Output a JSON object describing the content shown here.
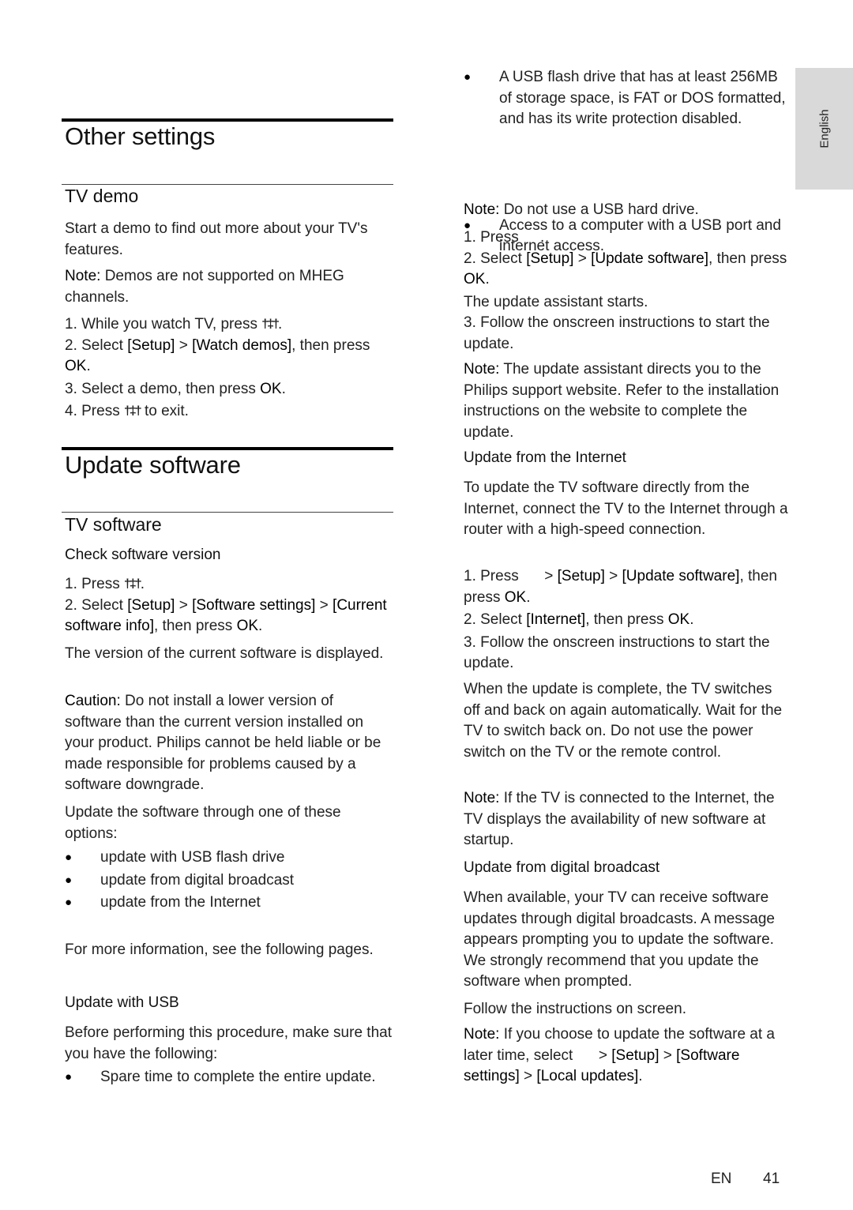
{
  "side_tab": {
    "language": "English"
  },
  "left": {
    "other_settings": {
      "title": "Other settings",
      "tv_demo": {
        "title": "TV demo",
        "intro": "Start a demo to find out more about your TV's features.",
        "note_label": "Note:",
        "note_text": " Demos are not supported on MHEG channels.",
        "step1_pre": "1. While you watch TV, press ",
        "step1_post": ".",
        "step2_pre": "2. Select ",
        "step2_a": "[Setup]",
        "step2_sep": " > ",
        "step2_b": "[Watch demos]",
        "step2_post": ", then press ",
        "step2_ok": "OK",
        "step2_end": ".",
        "step3_pre": "3. Select a demo, then press ",
        "step3_ok": "OK",
        "step3_end": ".",
        "step4_pre": "4. Press ",
        "step4_post": " to exit."
      }
    },
    "update_software": {
      "title": "Update software",
      "tv_software": {
        "title": "TV software",
        "check_heading": "Check software version",
        "step1_pre": "1. Press ",
        "step1_post": ".",
        "step2_pre": "2. Select ",
        "step2_a": "[Setup]",
        "sep": " > ",
        "step2_b": "[Software settings]",
        "step2_c": "[Current software info]",
        "step2_post": ", then press ",
        "ok": "OK",
        "dot": ".",
        "version_text": "The version of the current software is displayed.",
        "caution_label": "Caution:",
        "caution_text": " Do not install a lower version of software than the current version installed on your product. Philips cannot be held liable or be made responsible for problems caused by a software downgrade.",
        "options_intro": "Update the software through one of these options:",
        "options": [
          "update with USB flash drive",
          "update from digital broadcast",
          "update from the Internet"
        ],
        "more_info": "For more information, see the following pages.",
        "usb_heading": "Update with USB",
        "usb_intro": "Before performing this procedure, make sure that you have the following:",
        "usb_req_1": "Spare time to complete the entire update."
      }
    }
  },
  "right": {
    "usb_reqs": [
      "A USB flash drive that has at least 256MB of storage space, is FAT or DOS formatted, and has its write protection disabled.",
      "Access to a computer with a USB port and internet access."
    ],
    "usb_note_label": "Note:",
    "usb_note_text": " Do not use a USB hard drive.",
    "usb_step1_pre": "1. Press ",
    "usb_step1_post": ".",
    "usb_step2_pre": "2. Select ",
    "setup": "[Setup]",
    "sep": " > ",
    "update_software": "[Update software]",
    "then_press": ", then press ",
    "ok": "OK",
    "dot": ".",
    "assistant_starts": "The update assistant starts.",
    "follow_step3": "3. Follow the onscreen instructions to start the update.",
    "assistant_note_label": "Note:",
    "assistant_note_text": " The update assistant directs you to the Philips support website. Refer to the installation instructions on the website to complete the update.",
    "internet_heading": "Update from the Internet",
    "internet_intro": "To update the TV software directly from the Internet, connect the TV to the Internet through a router with a high-speed connection.",
    "internet_step1_pre": "1. Press ",
    "internet_step1_end": ",",
    "internet_step1_tail": "then press ",
    "internet_step2_pre": "2. Select ",
    "internet_option": "[Internet]",
    "internet_step3": "3. Follow the onscreen instructions to start the update.",
    "complete_text": "When the update is complete, the TV switches off and back on again automatically. Wait for the TV to switch back on. Do not use the power switch on the TV or the remote control.",
    "internet_note_label": "Note:",
    "internet_note_text": " If the TV is connected to the Internet, the TV displays the availability of new software at startup.",
    "broadcast_heading": "Update from digital broadcast",
    "broadcast_text": "When available, your TV can receive software updates through digital broadcasts. A message appears prompting you to update the software. We strongly recommend that you update the software when prompted.",
    "follow_instructions": "Follow the instructions on screen.",
    "later_note_label": "Note:",
    "later_note_text": " If you choose to update the software at a later time, select ",
    "software_settings": "[Software settings]",
    "local_updates": "[Local updates]"
  },
  "footer": {
    "lang": "EN",
    "page": "41"
  }
}
